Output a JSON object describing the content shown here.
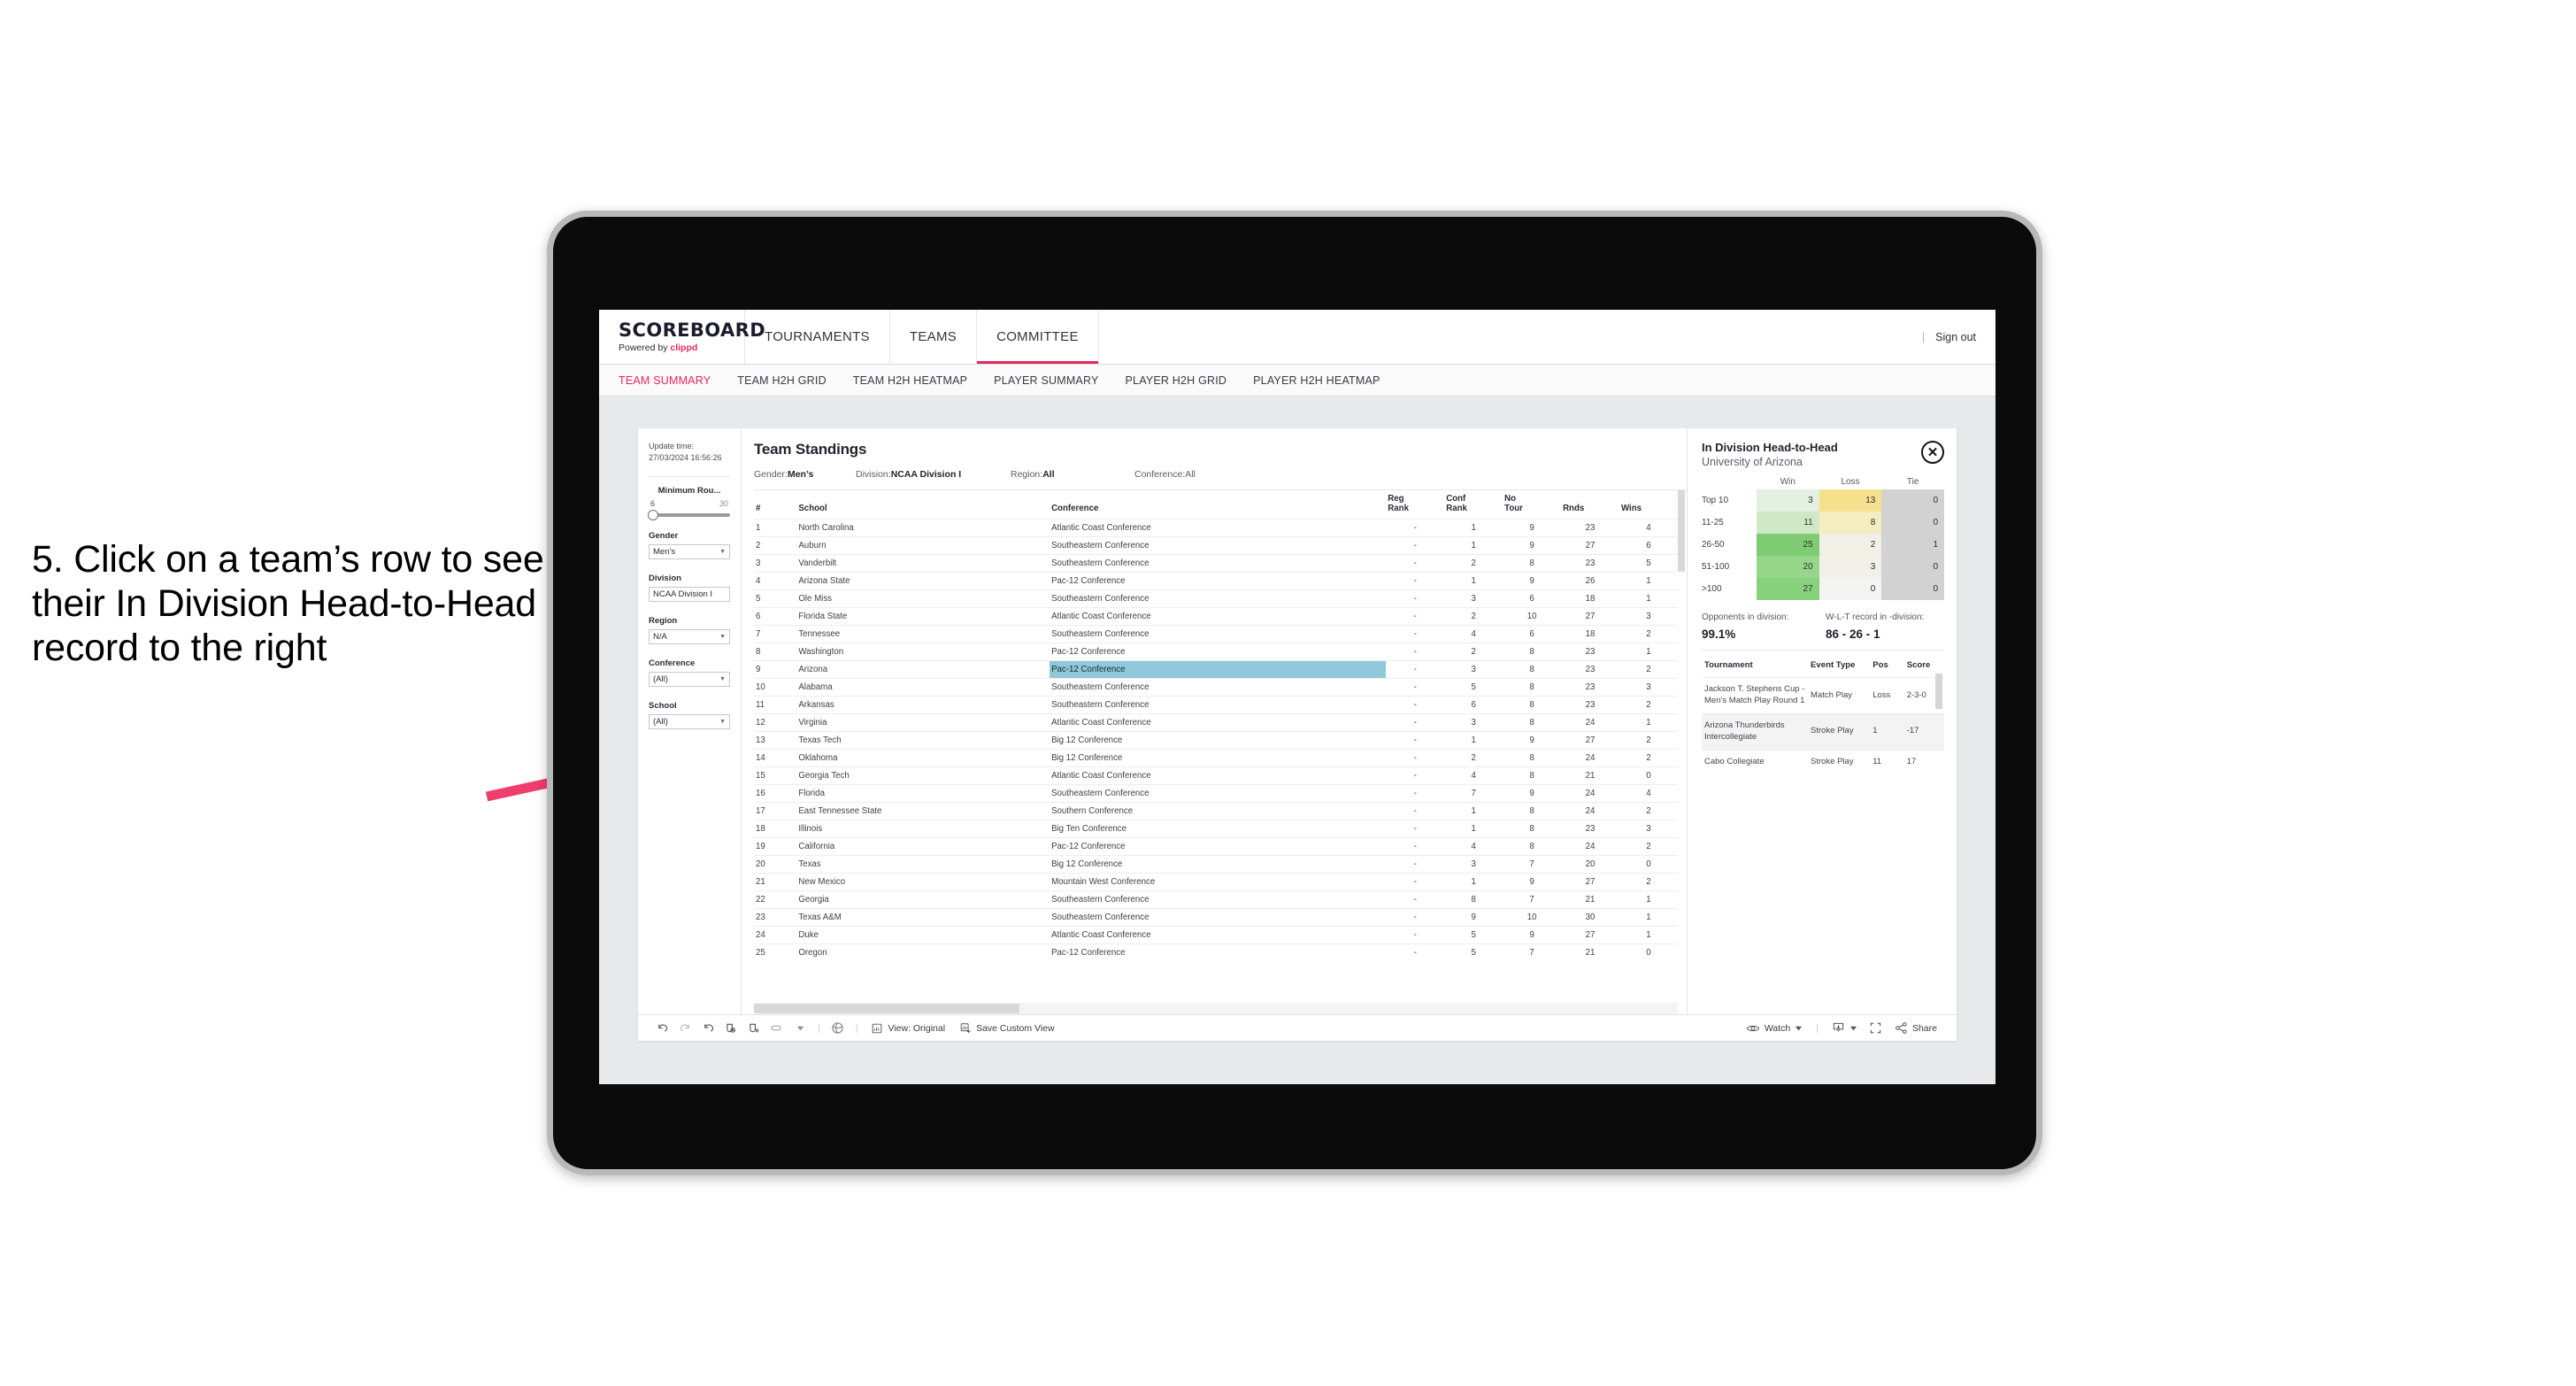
{
  "annotation": {
    "text": "5. Click on a team’s row to see their In Division Head-to-Head record to the right"
  },
  "colors": {
    "accent": "#e8285c",
    "selected_row": "#8ec8da",
    "win_scale": [
      "#e3efe1",
      "#cce9c4",
      "#86ce7f",
      "#9bd78f",
      "#8ed585"
    ],
    "loss_scale": [
      "#f4e08d",
      "#f5ecc0",
      "#f0eee4",
      "#f2efe7",
      "#f2f2f0"
    ],
    "tie": "#d2d2d2"
  },
  "app": {
    "brand": {
      "title": "SCOREBOARD",
      "powered_prefix": "Powered by ",
      "powered_name": "clippd"
    },
    "nav": [
      {
        "label": "TOURNAMENTS",
        "active": false
      },
      {
        "label": "TEAMS",
        "active": false
      },
      {
        "label": "COMMITTEE",
        "active": true
      }
    ],
    "header_right": {
      "separator": "|",
      "sign_out": "Sign out"
    },
    "subtabs": [
      {
        "label": "TEAM SUMMARY",
        "active": true
      },
      {
        "label": "TEAM H2H GRID",
        "active": false
      },
      {
        "label": "TEAM H2H HEATMAP",
        "active": false
      },
      {
        "label": "PLAYER SUMMARY",
        "active": false
      },
      {
        "label": "PLAYER H2H GRID",
        "active": false
      },
      {
        "label": "PLAYER H2H HEATMAP",
        "active": false
      }
    ]
  },
  "filters": {
    "update_time_label": "Update time:",
    "update_time_value": "27/03/2024 16:56:26",
    "min_rounds": {
      "label": "Minimum Rou...",
      "min": "6",
      "max": "30"
    },
    "gender": {
      "label": "Gender",
      "value": "Men’s"
    },
    "division": {
      "label": "Division",
      "value": "NCAA Division I"
    },
    "region": {
      "label": "Region",
      "value": "N/A"
    },
    "conference": {
      "label": "Conference",
      "value": "(All)"
    },
    "school": {
      "label": "School",
      "value": "(All)"
    }
  },
  "standings": {
    "title": "Team Standings",
    "meta": [
      {
        "label": "Gender: ",
        "value": "Men’s"
      },
      {
        "label": "Division: ",
        "value": "NCAA Division I"
      },
      {
        "label": "Region: ",
        "value": "All"
      },
      {
        "label": "Conference: ",
        "value": "All"
      }
    ],
    "columns": [
      "#",
      "School",
      "Conference",
      "Reg Rank",
      "Conf Rank",
      "No Tour",
      "Rnds",
      "Wins"
    ],
    "columns_wrapped": [
      {
        "l1": "#",
        "l2": ""
      },
      {
        "l1": "School",
        "l2": ""
      },
      {
        "l1": "Conference",
        "l2": ""
      },
      {
        "l1": "Reg",
        "l2": "Rank"
      },
      {
        "l1": "Conf",
        "l2": "Rank"
      },
      {
        "l1": "No",
        "l2": "Tour"
      },
      {
        "l1": "Rnds",
        "l2": ""
      },
      {
        "l1": "Wins",
        "l2": ""
      }
    ],
    "selected_rank": 9,
    "rows": [
      {
        "rank": "1",
        "school": "North Carolina",
        "conference": "Atlantic Coast Conference",
        "reg_rank": "-",
        "conf_rank": "1",
        "no_tour": "9",
        "rnds": "23",
        "wins": "4"
      },
      {
        "rank": "2",
        "school": "Auburn",
        "conference": "Southeastern Conference",
        "reg_rank": "-",
        "conf_rank": "1",
        "no_tour": "9",
        "rnds": "27",
        "wins": "6"
      },
      {
        "rank": "3",
        "school": "Vanderbilt",
        "conference": "Southeastern Conference",
        "reg_rank": "-",
        "conf_rank": "2",
        "no_tour": "8",
        "rnds": "23",
        "wins": "5"
      },
      {
        "rank": "4",
        "school": "Arizona State",
        "conference": "Pac-12 Conference",
        "reg_rank": "-",
        "conf_rank": "1",
        "no_tour": "9",
        "rnds": "26",
        "wins": "1"
      },
      {
        "rank": "5",
        "school": "Ole Miss",
        "conference": "Southeastern Conference",
        "reg_rank": "-",
        "conf_rank": "3",
        "no_tour": "6",
        "rnds": "18",
        "wins": "1"
      },
      {
        "rank": "6",
        "school": "Florida State",
        "conference": "Atlantic Coast Conference",
        "reg_rank": "-",
        "conf_rank": "2",
        "no_tour": "10",
        "rnds": "27",
        "wins": "3"
      },
      {
        "rank": "7",
        "school": "Tennessee",
        "conference": "Southeastern Conference",
        "reg_rank": "-",
        "conf_rank": "4",
        "no_tour": "6",
        "rnds": "18",
        "wins": "2"
      },
      {
        "rank": "8",
        "school": "Washington",
        "conference": "Pac-12 Conference",
        "reg_rank": "-",
        "conf_rank": "2",
        "no_tour": "8",
        "rnds": "23",
        "wins": "1"
      },
      {
        "rank": "9",
        "school": "Arizona",
        "conference": "Pac-12 Conference",
        "reg_rank": "-",
        "conf_rank": "3",
        "no_tour": "8",
        "rnds": "23",
        "wins": "2"
      },
      {
        "rank": "10",
        "school": "Alabama",
        "conference": "Southeastern Conference",
        "reg_rank": "-",
        "conf_rank": "5",
        "no_tour": "8",
        "rnds": "23",
        "wins": "3"
      },
      {
        "rank": "11",
        "school": "Arkansas",
        "conference": "Southeastern Conference",
        "reg_rank": "-",
        "conf_rank": "6",
        "no_tour": "8",
        "rnds": "23",
        "wins": "2"
      },
      {
        "rank": "12",
        "school": "Virginia",
        "conference": "Atlantic Coast Conference",
        "reg_rank": "-",
        "conf_rank": "3",
        "no_tour": "8",
        "rnds": "24",
        "wins": "1"
      },
      {
        "rank": "13",
        "school": "Texas Tech",
        "conference": "Big 12 Conference",
        "reg_rank": "-",
        "conf_rank": "1",
        "no_tour": "9",
        "rnds": "27",
        "wins": "2"
      },
      {
        "rank": "14",
        "school": "Oklahoma",
        "conference": "Big 12 Conference",
        "reg_rank": "-",
        "conf_rank": "2",
        "no_tour": "8",
        "rnds": "24",
        "wins": "2"
      },
      {
        "rank": "15",
        "school": "Georgia Tech",
        "conference": "Atlantic Coast Conference",
        "reg_rank": "-",
        "conf_rank": "4",
        "no_tour": "8",
        "rnds": "21",
        "wins": "0"
      },
      {
        "rank": "16",
        "school": "Florida",
        "conference": "Southeastern Conference",
        "reg_rank": "-",
        "conf_rank": "7",
        "no_tour": "9",
        "rnds": "24",
        "wins": "4"
      },
      {
        "rank": "17",
        "school": "East Tennessee State",
        "conference": "Southern Conference",
        "reg_rank": "-",
        "conf_rank": "1",
        "no_tour": "8",
        "rnds": "24",
        "wins": "2"
      },
      {
        "rank": "18",
        "school": "Illinois",
        "conference": "Big Ten Conference",
        "reg_rank": "-",
        "conf_rank": "1",
        "no_tour": "8",
        "rnds": "23",
        "wins": "3"
      },
      {
        "rank": "19",
        "school": "California",
        "conference": "Pac-12 Conference",
        "reg_rank": "-",
        "conf_rank": "4",
        "no_tour": "8",
        "rnds": "24",
        "wins": "2"
      },
      {
        "rank": "20",
        "school": "Texas",
        "conference": "Big 12 Conference",
        "reg_rank": "-",
        "conf_rank": "3",
        "no_tour": "7",
        "rnds": "20",
        "wins": "0"
      },
      {
        "rank": "21",
        "school": "New Mexico",
        "conference": "Mountain West Conference",
        "reg_rank": "-",
        "conf_rank": "1",
        "no_tour": "9",
        "rnds": "27",
        "wins": "2"
      },
      {
        "rank": "22",
        "school": "Georgia",
        "conference": "Southeastern Conference",
        "reg_rank": "-",
        "conf_rank": "8",
        "no_tour": "7",
        "rnds": "21",
        "wins": "1"
      },
      {
        "rank": "23",
        "school": "Texas A&M",
        "conference": "Southeastern Conference",
        "reg_rank": "-",
        "conf_rank": "9",
        "no_tour": "10",
        "rnds": "30",
        "wins": "1"
      },
      {
        "rank": "24",
        "school": "Duke",
        "conference": "Atlantic Coast Conference",
        "reg_rank": "-",
        "conf_rank": "5",
        "no_tour": "9",
        "rnds": "27",
        "wins": "1"
      },
      {
        "rank": "25",
        "school": "Oregon",
        "conference": "Pac-12 Conference",
        "reg_rank": "-",
        "conf_rank": "5",
        "no_tour": "7",
        "rnds": "21",
        "wins": "0"
      }
    ]
  },
  "detail": {
    "title": "In Division Head-to-Head",
    "subtitle": "University of Arizona",
    "close_icon": "✕",
    "h2h": {
      "columns": [
        "Win",
        "Loss",
        "Tie"
      ],
      "rows": [
        {
          "label": "Top 10",
          "win": "3",
          "loss": "13",
          "tie": "0",
          "win_color": "#e3efe1",
          "loss_color": "#f4e08d",
          "tie_color": "#d2d2d2"
        },
        {
          "label": "11-25",
          "win": "11",
          "loss": "8",
          "tie": "0",
          "win_color": "#cfe9c6",
          "loss_color": "#f5ecc0",
          "tie_color": "#d2d2d2"
        },
        {
          "label": "26-50",
          "win": "25",
          "loss": "2",
          "tie": "1",
          "win_color": "#7ecb74",
          "loss_color": "#f1efe6",
          "tie_color": "#d2d2d2"
        },
        {
          "label": "51-100",
          "win": "20",
          "loss": "3",
          "tie": "0",
          "win_color": "#96d689",
          "loss_color": "#f2f0e8",
          "tie_color": "#d2d2d2"
        },
        {
          "label": ">100",
          "win": "27",
          "loss": "0",
          "tie": "0",
          "win_color": "#87d17c",
          "loss_color": "#f3f3f1",
          "tie_color": "#d2d2d2"
        }
      ]
    },
    "stats": [
      {
        "label": "Opponents in division:",
        "value": "99.1%"
      },
      {
        "label": "W-L-T record in -division:",
        "value": "86 - 26 - 1"
      }
    ],
    "tournaments": {
      "columns": [
        "Tournament",
        "Event Type",
        "Pos",
        "Score"
      ],
      "rows": [
        {
          "tournament": "Jackson T. Stephens Cup - Men’s Match Play Round 1",
          "event_type": "Match Play",
          "pos": "Loss",
          "score": "2-3-0"
        },
        {
          "tournament": "Arizona Thunderbirds Intercollegiate",
          "event_type": "Stroke Play",
          "pos": "1",
          "score": "-17"
        },
        {
          "tournament": "Cabo Collegiate",
          "event_type": "Stroke Play",
          "pos": "11",
          "score": "17"
        }
      ]
    }
  },
  "toolbar": {
    "icons": [
      "undo-icon",
      "redo-icon",
      "revert-icon",
      "refresh-data-icon",
      "pause-updates-icon",
      "highlight-icon",
      "chevron-down-icon"
    ],
    "view_label": "View: Original",
    "save_custom_view_label": "Save Custom View",
    "watch_label": "Watch",
    "share_label": "Share"
  }
}
